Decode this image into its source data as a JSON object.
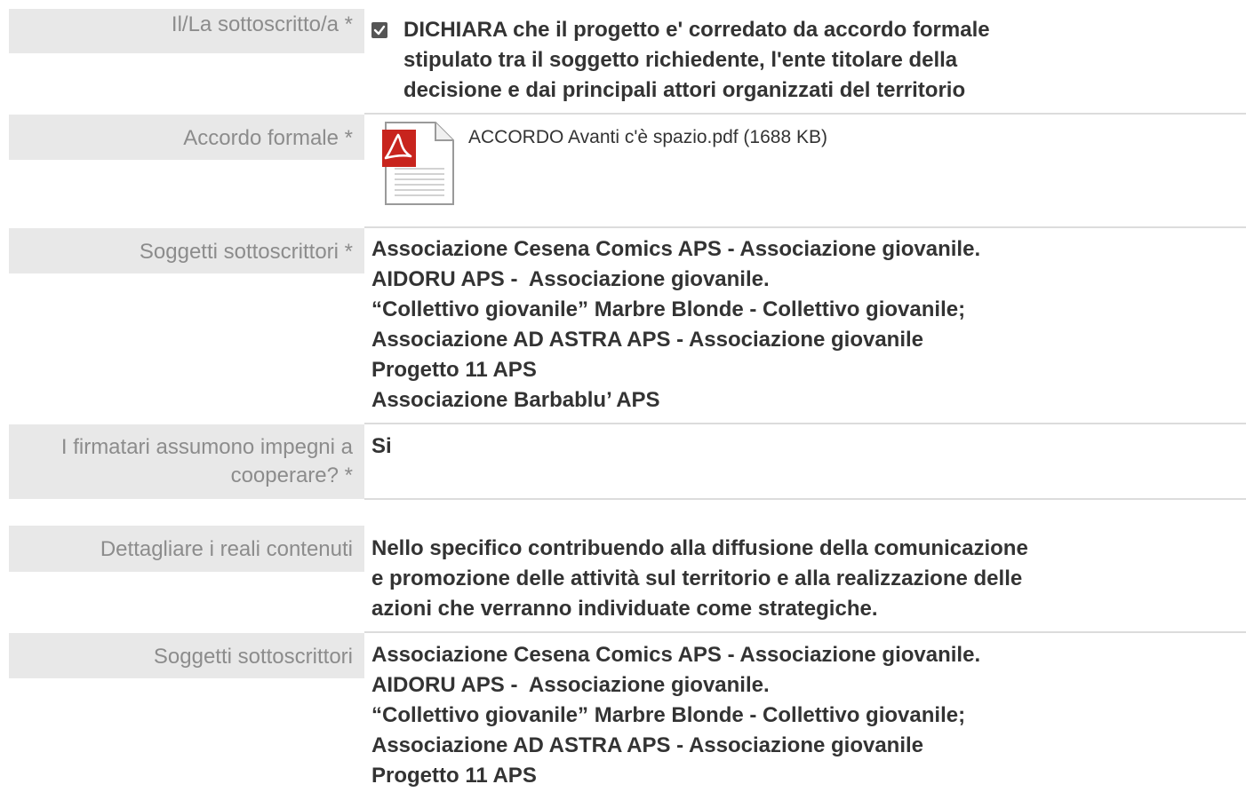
{
  "rows": {
    "declaration": {
      "label": "Il/La sottoscritto/a *",
      "checked": true,
      "text_lines": [
        "DICHIARA che il progetto e' corredato da accordo formale",
        "stipulato tra il soggetto richiedente, l'ente titolare della",
        "decisione e dai principali attori organizzati del territorio"
      ]
    },
    "agreement": {
      "label": "Accordo formale *",
      "icon": "pdf-file-icon",
      "file_text": "ACCORDO Avanti c'è spazio.pdf (1688 KB)"
    },
    "signatories": {
      "label": "Soggetti sottoscrittori *",
      "lines": [
        "Associazione Cesena Comics APS - Associazione giovanile.",
        "AIDORU APS -  Associazione giovanile.",
        "“Collettivo giovanile” Marbre Blonde - Collettivo giovanile;",
        "Associazione AD ASTRA APS - Associazione giovanile",
        "Progetto 11 APS",
        "Associazione Barbablu’ APS"
      ]
    },
    "cooperate": {
      "label_line1": "I firmatari assumono impegni a",
      "label_line2": "cooperare? *",
      "value": "Si"
    },
    "details": {
      "label": "Dettagliare i reali contenuti",
      "lines": [
        "Nello specifico contribuendo alla diffusione della comunicazione",
        "e promozione delle attività sul territorio e alla realizzazione delle",
        "azioni che verranno individuate come strategiche."
      ]
    },
    "signatories2": {
      "label": "Soggetti sottoscrittori",
      "lines": [
        "Associazione Cesena Comics APS - Associazione giovanile.",
        "AIDORU APS -  Associazione giovanile.",
        "“Collettivo giovanile” Marbre Blonde - Collettivo giovanile;",
        "Associazione AD ASTRA APS - Associazione giovanile",
        "Progetto 11 APS"
      ]
    }
  },
  "colors": {
    "label_bg": "#e8e8e8",
    "label_text": "#8c8c8c",
    "value_text": "#333333",
    "divider": "#dcdcdc",
    "pdf_red": "#c8241d"
  }
}
